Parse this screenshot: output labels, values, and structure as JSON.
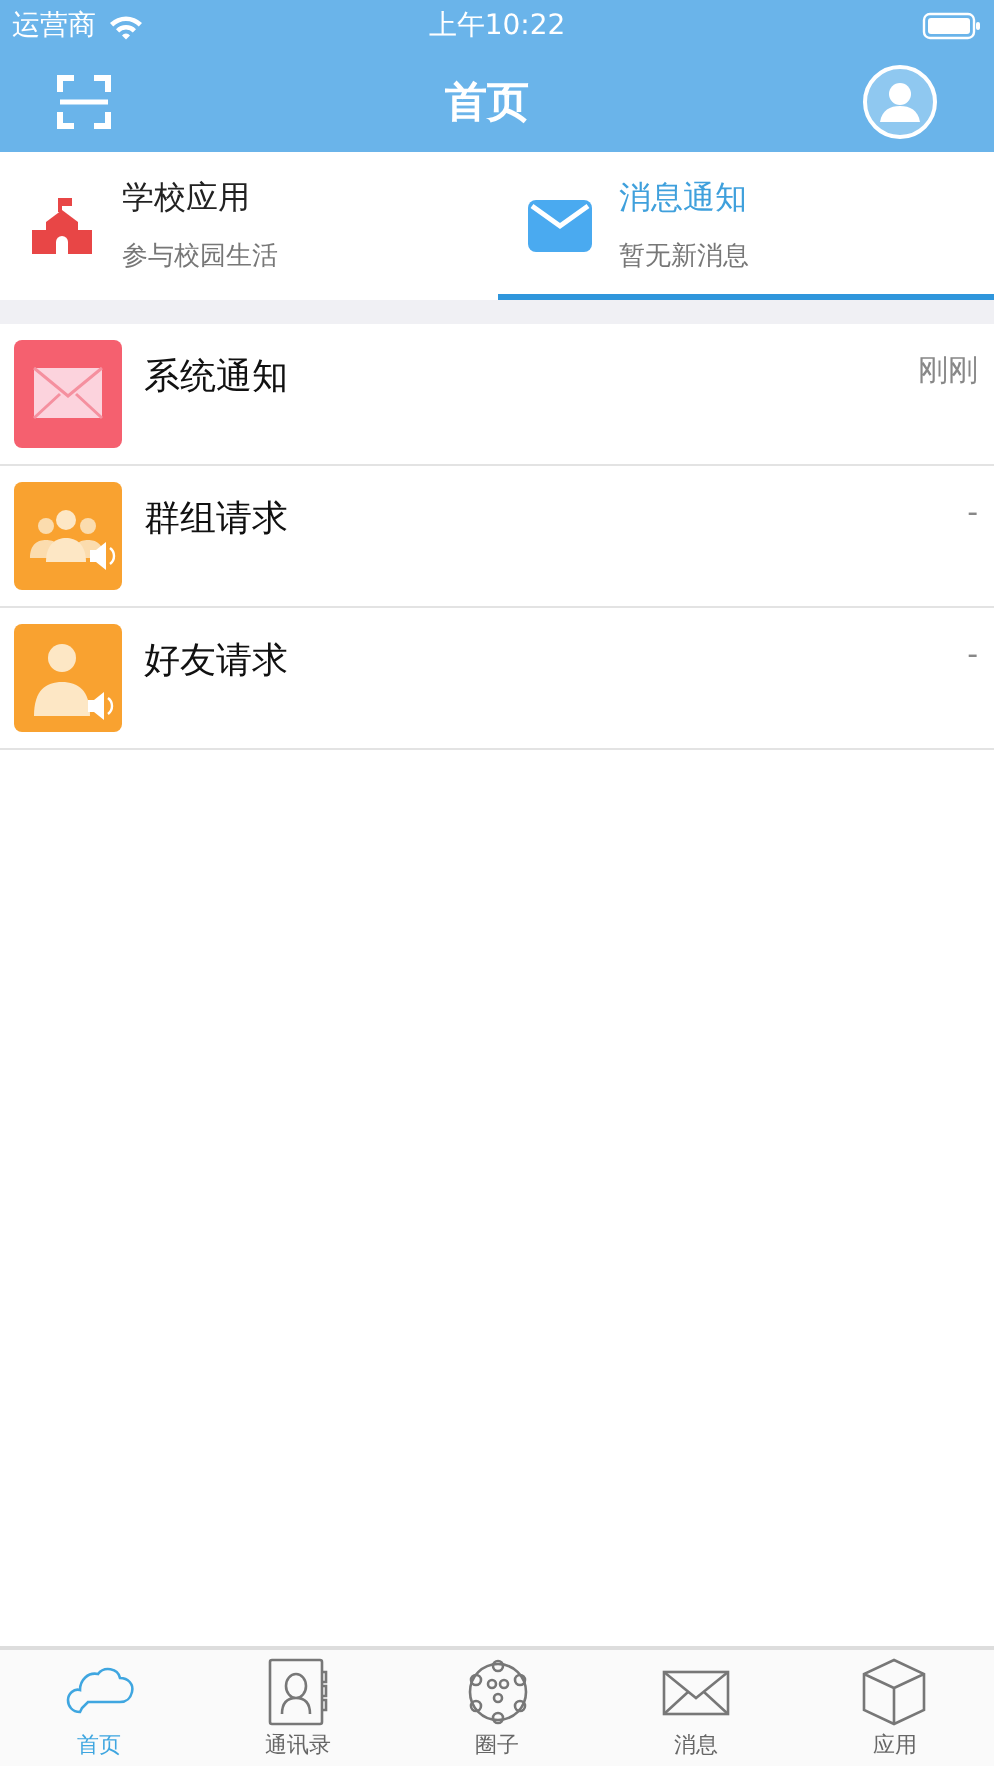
{
  "status_bar": {
    "carrier": "运营商",
    "time": "上午10:22"
  },
  "nav_bar": {
    "title": "首页"
  },
  "segments": [
    {
      "kind": "school",
      "title": "学校应用",
      "subtitle": "参与校园生活",
      "selected": false
    },
    {
      "kind": "mail",
      "title": "消息通知",
      "subtitle": "暂无新消息",
      "selected": true
    }
  ],
  "messages": [
    {
      "kind": "mail",
      "title": "系统通知",
      "time": "刚刚",
      "color": "#f5606f"
    },
    {
      "kind": "group",
      "title": "群组请求",
      "time": "-",
      "color": "#f9a230"
    },
    {
      "kind": "friend",
      "title": "好友请求",
      "time": "-",
      "color": "#f9a230"
    }
  ],
  "tab_bar": [
    {
      "kind": "cloud",
      "label": "首页",
      "selected": true
    },
    {
      "kind": "contacts",
      "label": "通讯录",
      "selected": false
    },
    {
      "kind": "circle",
      "label": "圈子",
      "selected": false
    },
    {
      "kind": "mail",
      "label": "消息",
      "selected": false
    },
    {
      "kind": "cube",
      "label": "应用",
      "selected": false
    }
  ]
}
